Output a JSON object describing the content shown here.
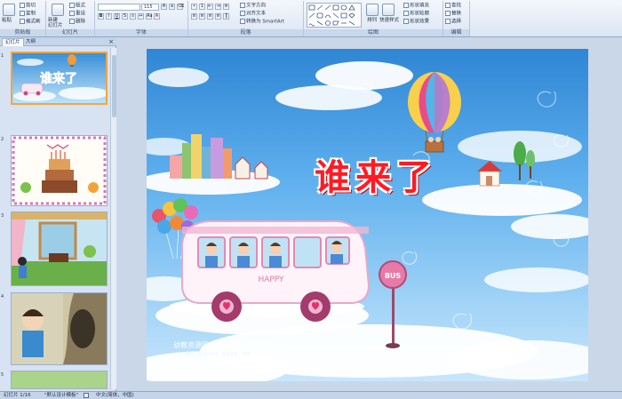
{
  "ribbon": {
    "clipboard": {
      "paste": "粘贴",
      "cut": "剪切",
      "copy": "复制",
      "format_painter": "格式刷",
      "label": "剪贴板"
    },
    "slides": {
      "new_slide": "新建\n幻灯片",
      "layout": "版式",
      "reset": "重设",
      "delete": "删除",
      "label": "幻灯片"
    },
    "font": {
      "font_name": "",
      "font_size": "115",
      "label": "字体"
    },
    "paragraph": {
      "text_direction": "文字方向",
      "align_text": "对齐文本",
      "smartart": "转换为 SmartArt",
      "label": "段落"
    },
    "drawing": {
      "arrange": "排列",
      "quick_styles": "快速样式",
      "shape_fill": "形状填充",
      "shape_outline": "形状轮廓",
      "shape_effects": "形状效果",
      "label": "绘图"
    },
    "editing": {
      "find": "查找",
      "replace": "替换",
      "select": "选择",
      "label": "编辑"
    }
  },
  "left_pane": {
    "tabs": [
      "幻灯片",
      "大纲"
    ],
    "close": "×",
    "slide_numbers": [
      "1",
      "2",
      "3",
      "4",
      "5"
    ]
  },
  "slide": {
    "title": "谁来了",
    "bus_label": "HAPPY",
    "bus_stop": "BUS",
    "watermark": "幼教资源网 ziyuan.baby611.com",
    "watermark_sub": "PPT课件 · FLASH课件 · 教案教参 · 试卷"
  },
  "status": {
    "slide_position": "幻灯片 1/16",
    "theme": "\"默认设计模板\"",
    "language": "中文(简体，中国)"
  },
  "colors": {
    "title_red": "#ff1b24",
    "selected_thumb": "#f0a640",
    "sky_top": "#2f86d4"
  }
}
